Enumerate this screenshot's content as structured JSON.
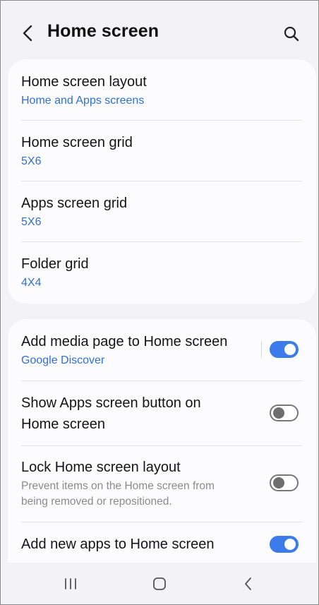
{
  "header": {
    "back_icon": "chevron-left-icon",
    "title": "Home screen",
    "search_icon": "search-icon"
  },
  "layout_section": {
    "items": [
      {
        "title": "Home screen layout",
        "value": "Home and Apps screens"
      },
      {
        "title": "Home screen grid",
        "value": "5X6"
      },
      {
        "title": "Apps screen grid",
        "value": "5X6"
      },
      {
        "title": "Folder grid",
        "value": "4X4"
      }
    ]
  },
  "toggles_section": {
    "items": [
      {
        "title": "Add media page to Home screen",
        "subtitle": "Google Discover",
        "enabled": true
      },
      {
        "title_line1": "Show Apps screen button on",
        "title_line2": "Home screen",
        "enabled": false
      },
      {
        "title": "Lock Home screen layout",
        "desc_line1": "Prevent items on the Home screen from",
        "desc_line2": "being removed or repositioned.",
        "enabled": false
      },
      {
        "title": "Add new apps to Home screen",
        "enabled": true
      }
    ]
  },
  "navbar": {
    "recents_icon": "recent-apps-icon",
    "home_icon": "home-icon",
    "back_icon": "back-icon"
  },
  "colors": {
    "accent": "#3e7bea",
    "link_text": "#2f6fd6",
    "background": "#f3f3f5",
    "card": "#fcfcfe"
  }
}
